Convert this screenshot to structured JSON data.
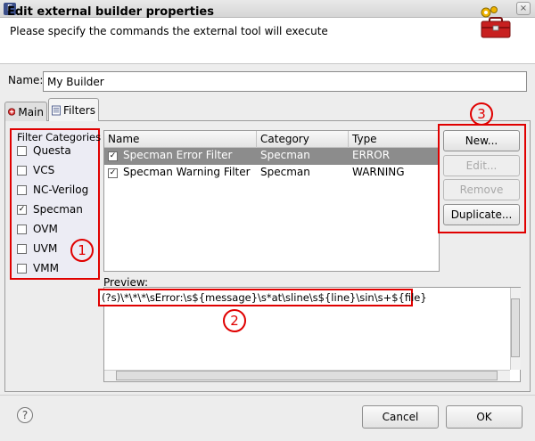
{
  "window": {
    "close_glyph": "×"
  },
  "header": {
    "title": "Edit external builder properties",
    "subtitle": "Please specify the commands the external tool will execute"
  },
  "name": {
    "label": "Name:",
    "value": "My Builder"
  },
  "tabs": [
    {
      "label": "Main",
      "icon": "run-config-icon",
      "active": false
    },
    {
      "label": "Filters",
      "icon": "filter-page-icon",
      "active": true
    }
  ],
  "categories": {
    "title": "Filter Categories",
    "items": [
      {
        "label": "Questa",
        "checked": false
      },
      {
        "label": "VCS",
        "checked": false
      },
      {
        "label": "NC-Verilog",
        "checked": false
      },
      {
        "label": "Specman",
        "checked": true
      },
      {
        "label": "OVM",
        "checked": false
      },
      {
        "label": "UVM",
        "checked": false
      },
      {
        "label": "VMM",
        "checked": false
      }
    ]
  },
  "table": {
    "columns": [
      "Name",
      "Category",
      "Type"
    ],
    "rows": [
      {
        "name": "Specman Error Filter",
        "category": "Specman",
        "type": "ERROR",
        "checked": true,
        "selected": true
      },
      {
        "name": "Specman Warning Filter",
        "category": "Specman",
        "type": "WARNING",
        "checked": true,
        "selected": false
      }
    ]
  },
  "buttons": {
    "new": "New...",
    "edit": "Edit...",
    "remove": "Remove",
    "duplicate": "Duplicate..."
  },
  "preview": {
    "label": "Preview:",
    "text": "(?s)\\*\\*\\*\\sError:\\s${message}\\s*at\\sline\\s${line}\\sin\\s+${file}"
  },
  "annotations": [
    "1",
    "2",
    "3"
  ],
  "footer": {
    "help": "?",
    "cancel": "Cancel",
    "ok": "OK"
  },
  "colors": {
    "annotation": "#e00000",
    "selection": "#8c8c8c",
    "category_bg": "#ececf4"
  }
}
